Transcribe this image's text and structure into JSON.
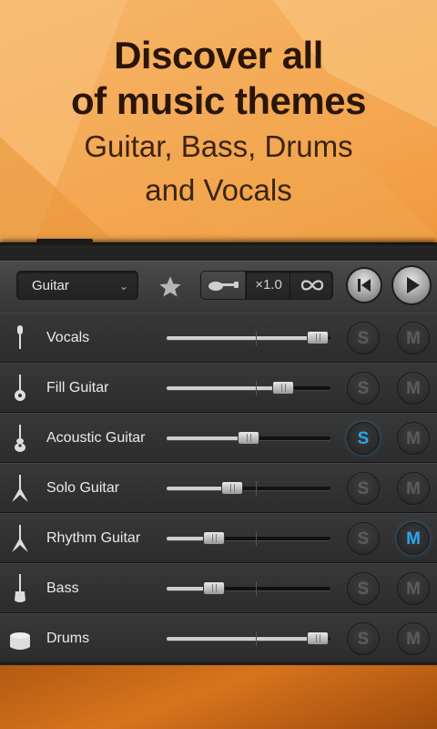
{
  "promo": {
    "line1": "Discover all",
    "line2": "of music themes",
    "line3": "Guitar, Bass, Drums",
    "line4": "and Vocals"
  },
  "toolbar": {
    "instrument": "Guitar",
    "speed_label": "×1.0",
    "icons": [
      "star-icon",
      "guitar-icon",
      "infinity-icon",
      "skip-back-icon",
      "play-icon"
    ]
  },
  "colors": {
    "accent": "#2aa6ef",
    "panel": "#2c2c2c"
  },
  "tracks": [
    {
      "name": "Vocals",
      "icon": "microphone-icon",
      "level": 0.92,
      "solo": false,
      "mute": false
    },
    {
      "name": "Fill Guitar",
      "icon": "guitar-icon",
      "level": 0.71,
      "solo": false,
      "mute": false
    },
    {
      "name": "Acoustic Guitar",
      "icon": "acoustic-guitar-icon",
      "level": 0.5,
      "solo": true,
      "mute": false
    },
    {
      "name": "Solo Guitar",
      "icon": "electric-guitar-icon",
      "level": 0.4,
      "solo": false,
      "mute": false
    },
    {
      "name": "Rhythm Guitar",
      "icon": "electric-guitar-icon",
      "level": 0.29,
      "solo": false,
      "mute": true
    },
    {
      "name": "Bass",
      "icon": "bass-icon",
      "level": 0.29,
      "solo": false,
      "mute": false
    },
    {
      "name": "Drums",
      "icon": "drum-icon",
      "level": 0.92,
      "solo": false,
      "mute": false
    }
  ],
  "solo_label": "S",
  "mute_label": "M"
}
